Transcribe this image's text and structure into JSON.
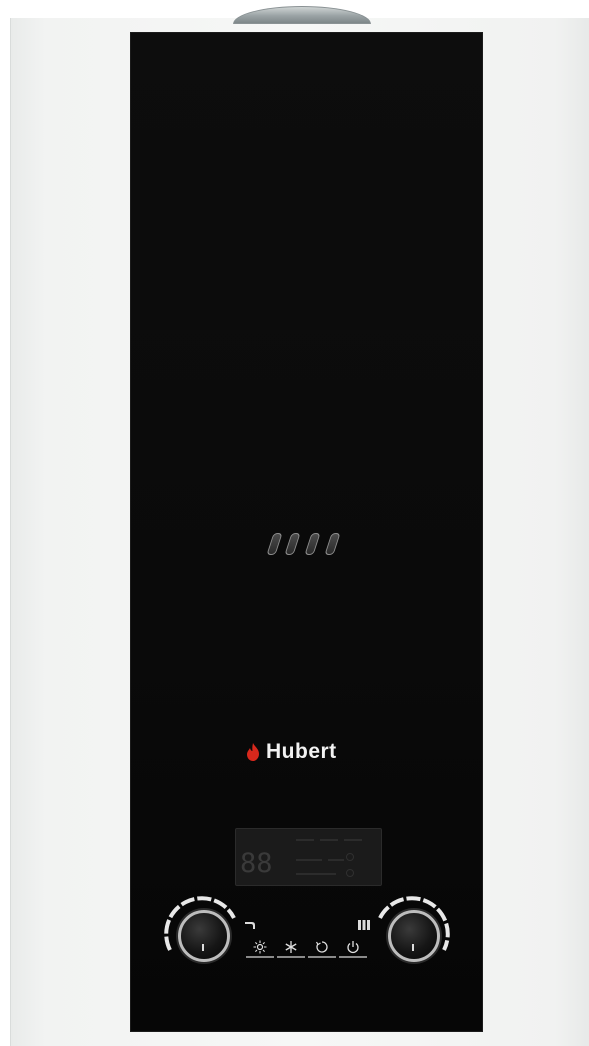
{
  "brand": {
    "name": "Hubert",
    "flame_color": "#d8281c"
  },
  "display": {
    "digits": "88"
  },
  "controls": {
    "left_knob": {
      "icon": "tap-icon"
    },
    "right_knob": {
      "icon": "radiator-icon"
    },
    "buttons": [
      {
        "icon": "sun-icon"
      },
      {
        "icon": "snowflake-icon"
      },
      {
        "icon": "reset-icon"
      },
      {
        "icon": "power-icon"
      }
    ]
  },
  "colors": {
    "panel": "#0a0a0a",
    "body": "#f4f5f4",
    "knob_ring": "#bdbdbd"
  }
}
